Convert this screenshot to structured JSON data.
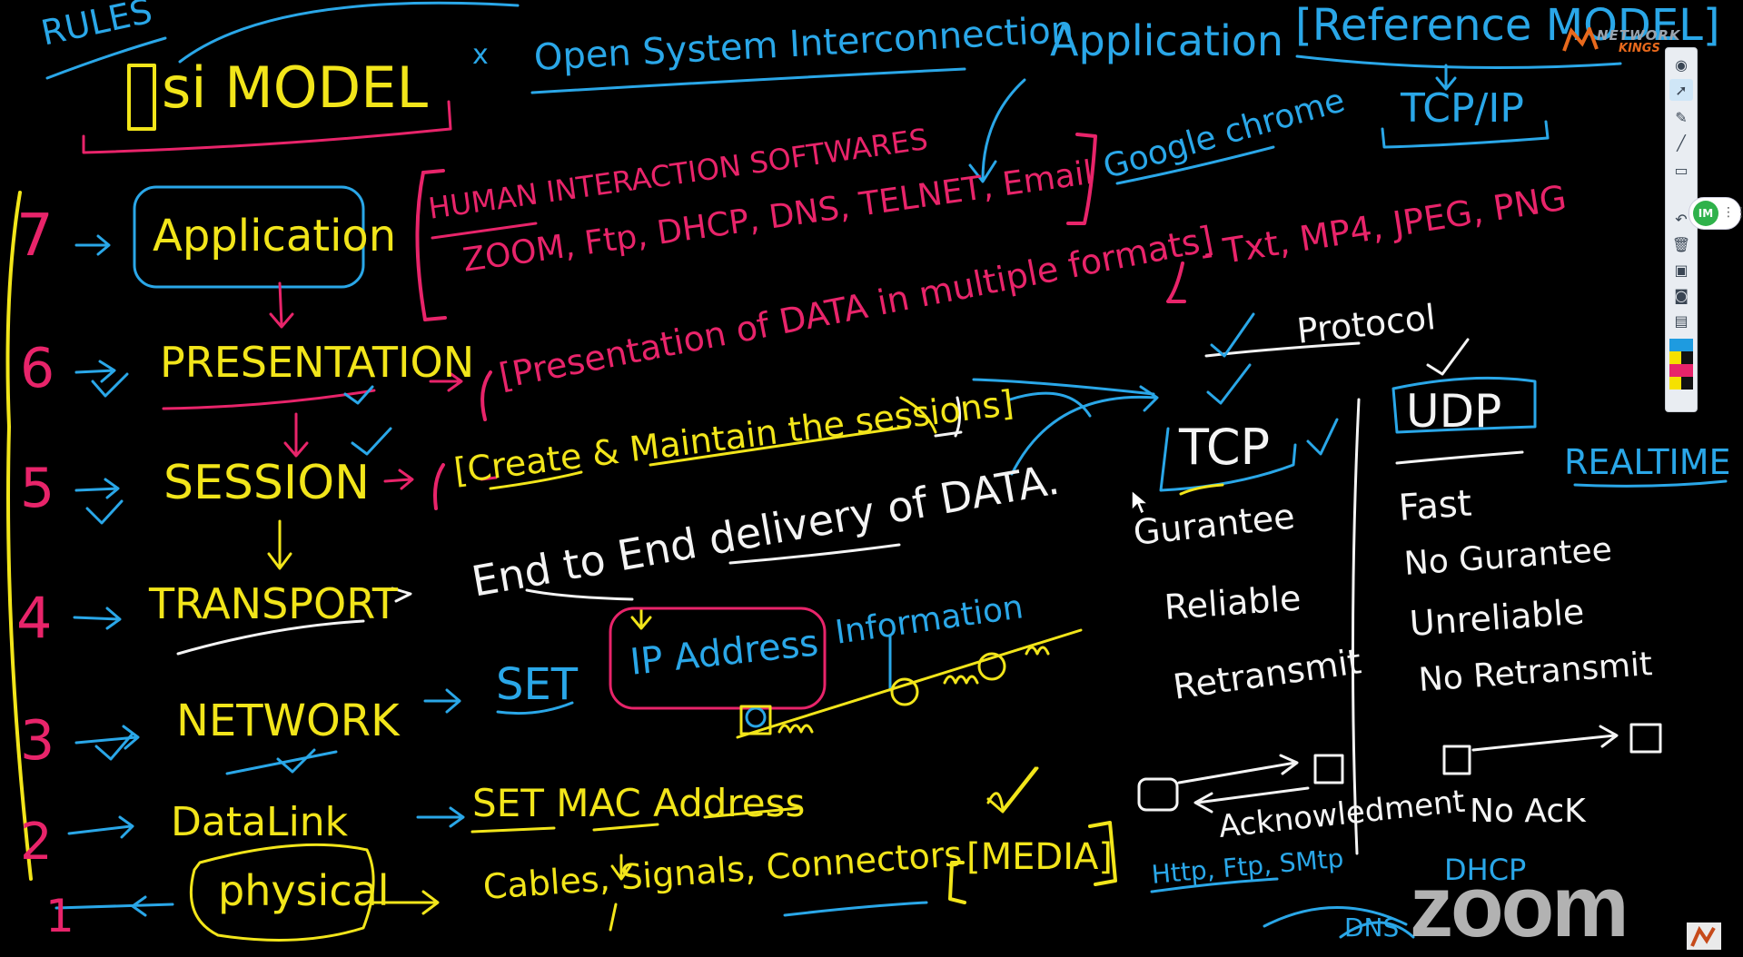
{
  "whiteboard": {
    "rules": "RULES",
    "osi_title": "si MODEL",
    "open_system": "Open System Interconnection",
    "application_label": "Application",
    "reference_model": "[Reference MODEL]",
    "tcp_ip": "TCP/IP",
    "x_mark": "x",
    "layers": [
      {
        "num": "7",
        "name": "Application",
        "desc": "HUMAN INTERACTION SOFTWARES",
        "desc2": "ZOOM, Ftp, DHCP, DNS, TELNET, Email"
      },
      {
        "num": "6",
        "name": "PRESENTATION",
        "desc": "[Presentation of DATA in multiple formats]",
        "extra": "- Txt, MP4, JPEG, PNG"
      },
      {
        "num": "5",
        "name": "SESSION",
        "desc": "[Create & Maintain the sessions]"
      },
      {
        "num": "4",
        "name": "TRANSPORT",
        "desc": "End to End delivery of DATA."
      },
      {
        "num": "3",
        "name": "NETWORK",
        "desc": "SET",
        "desc2": "IP Address",
        "extra": "Information"
      },
      {
        "num": "2",
        "name": "DataLink",
        "desc": "SET MAC Address"
      },
      {
        "num": "1",
        "name": "physical",
        "desc": "Cables, Signals, Connectors",
        "extra": "[MEDIA]"
      }
    ],
    "google_chrome": "Google chrome",
    "protocol": "Protocol",
    "tcp": {
      "title": "TCP",
      "props": [
        "Gurantee",
        "Reliable",
        "Retransmit"
      ],
      "ack": "Acknowledment",
      "apps": "Http, Ftp, SMtp",
      "dns": "DNS"
    },
    "udp": {
      "title": "UDP",
      "props": [
        "Fast",
        "No Gurantee",
        "Unreliable",
        "No Retransmit"
      ],
      "ack": "No AcK",
      "apps": "DHCP"
    },
    "realtime": "REALTIME"
  },
  "branding": {
    "logo_line1": "NETWORK",
    "logo_line2": "KINGS",
    "watermark": "zoom",
    "presenter_initials": "IM"
  },
  "toolbar": {
    "tools": [
      "eye-icon",
      "pointer-icon",
      "pen-icon",
      "highlighter-icon",
      "eraser-icon",
      "undo-icon",
      "trash-icon",
      "save-icon",
      "camera-icon",
      "clipboard-icon"
    ],
    "colors": [
      "#1e9be0",
      "#f5e100",
      "#111111",
      "#e8246a",
      "#f5e100"
    ]
  }
}
